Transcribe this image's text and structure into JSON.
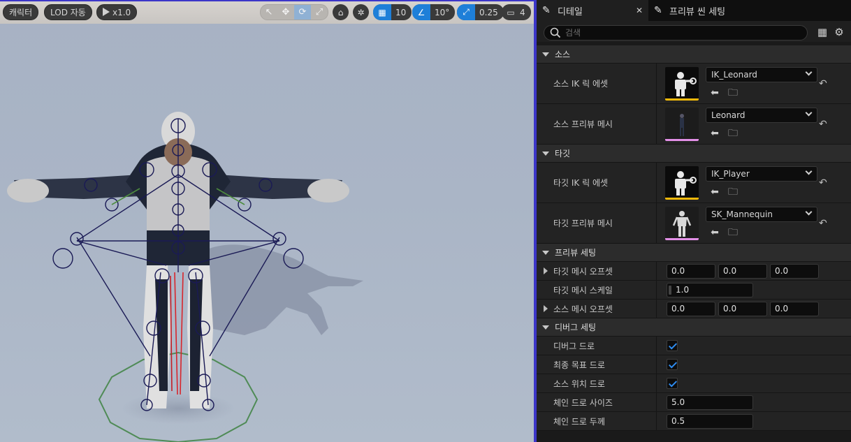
{
  "viewport": {
    "toolbar": {
      "character_label": "캐릭터",
      "lod_label": "LOD 자동",
      "play_speed": "x1.0",
      "grid_snap_value": "10",
      "angle_snap_value": "10°",
      "scale_snap_value": "0.25",
      "camera_speed_value": "4"
    }
  },
  "tabs": [
    {
      "label": "디테일",
      "icon": "pencil-icon",
      "active": true
    },
    {
      "label": "프리뷰 씬 세팅",
      "icon": "pencil-icon",
      "active": false
    }
  ],
  "search": {
    "placeholder": "검색"
  },
  "sections": {
    "source": {
      "title": "소스",
      "ik_rig": {
        "label": "소스 IK 릭 에셋",
        "value": "IK_Leonard",
        "bar_color": "#f2b90a"
      },
      "preview_mesh": {
        "label": "소스 프리뷰 메시",
        "value": "Leonard",
        "bar_color": "#e28fe6"
      }
    },
    "target": {
      "title": "타깃",
      "ik_rig": {
        "label": "타깃 IK 릭 에셋",
        "value": "IK_Player",
        "bar_color": "#f2b90a"
      },
      "preview_mesh": {
        "label": "타깃 프리뷰 메시",
        "value": "SK_Mannequin",
        "bar_color": "#e28fe6"
      }
    },
    "preview": {
      "title": "프리뷰 세팅",
      "target_offset": {
        "label": "타깃 메시 오프셋",
        "x": "0.0",
        "y": "0.0",
        "z": "0.0"
      },
      "target_scale": {
        "label": "타깃 메시 스케일",
        "value": "1.0"
      },
      "source_offset": {
        "label": "소스 메시 오프셋",
        "x": "0.0",
        "y": "0.0",
        "z": "0.0"
      }
    },
    "debug": {
      "title": "디버그 세팅",
      "draw_debug": {
        "label": "디버그 드로",
        "checked": true
      },
      "draw_final_goals": {
        "label": "최종 목표 드로",
        "checked": true
      },
      "draw_source_locations": {
        "label": "소스 위치 드로",
        "checked": true
      },
      "chain_draw_size": {
        "label": "체인 드로 사이즈",
        "value": "5.0"
      },
      "chain_draw_thickness": {
        "label": "체인 드로 두께",
        "value": "0.5"
      }
    }
  },
  "colors": {
    "accent": "#1e7fd8",
    "viewport_border": "#3c36c8",
    "checkbox": "#2f8cf0"
  }
}
